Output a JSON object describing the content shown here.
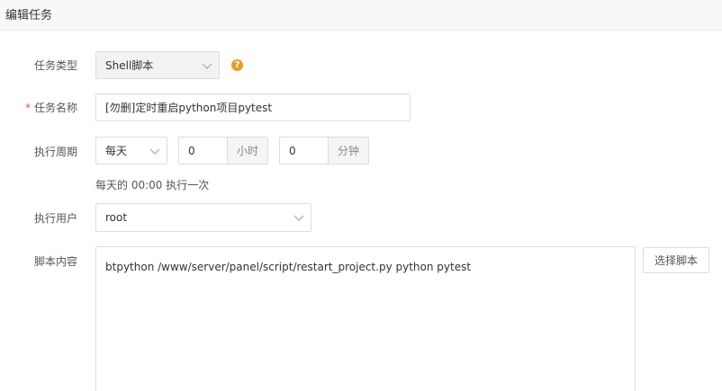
{
  "dialog": {
    "title": "编辑任务"
  },
  "form": {
    "task_type": {
      "label": "任务类型",
      "value": "Shell脚本",
      "help_glyph": "?"
    },
    "task_name": {
      "required_mark": "*",
      "label": "任务名称",
      "value": "[勿删]定时重启python项目pytest"
    },
    "period": {
      "label": "执行周期",
      "frequency": "每天",
      "hour_value": "0",
      "hour_unit": "小时",
      "minute_value": "0",
      "minute_unit": "分钟",
      "summary": "每天的 00:00 执行一次"
    },
    "user": {
      "label": "执行用户",
      "value": "root"
    },
    "script": {
      "label": "脚本内容",
      "content": "btpython /www/server/panel/script/restart_project.py python pytest",
      "select_button": "选择脚本"
    }
  },
  "colors": {
    "required": "#e74c3c",
    "help": "#e59e2a",
    "header_bg": "#f8f8f8",
    "border": "#dcdcdc"
  },
  "icons": {
    "help": "question-circle-icon",
    "dropdown": "chevron-down-icon"
  }
}
